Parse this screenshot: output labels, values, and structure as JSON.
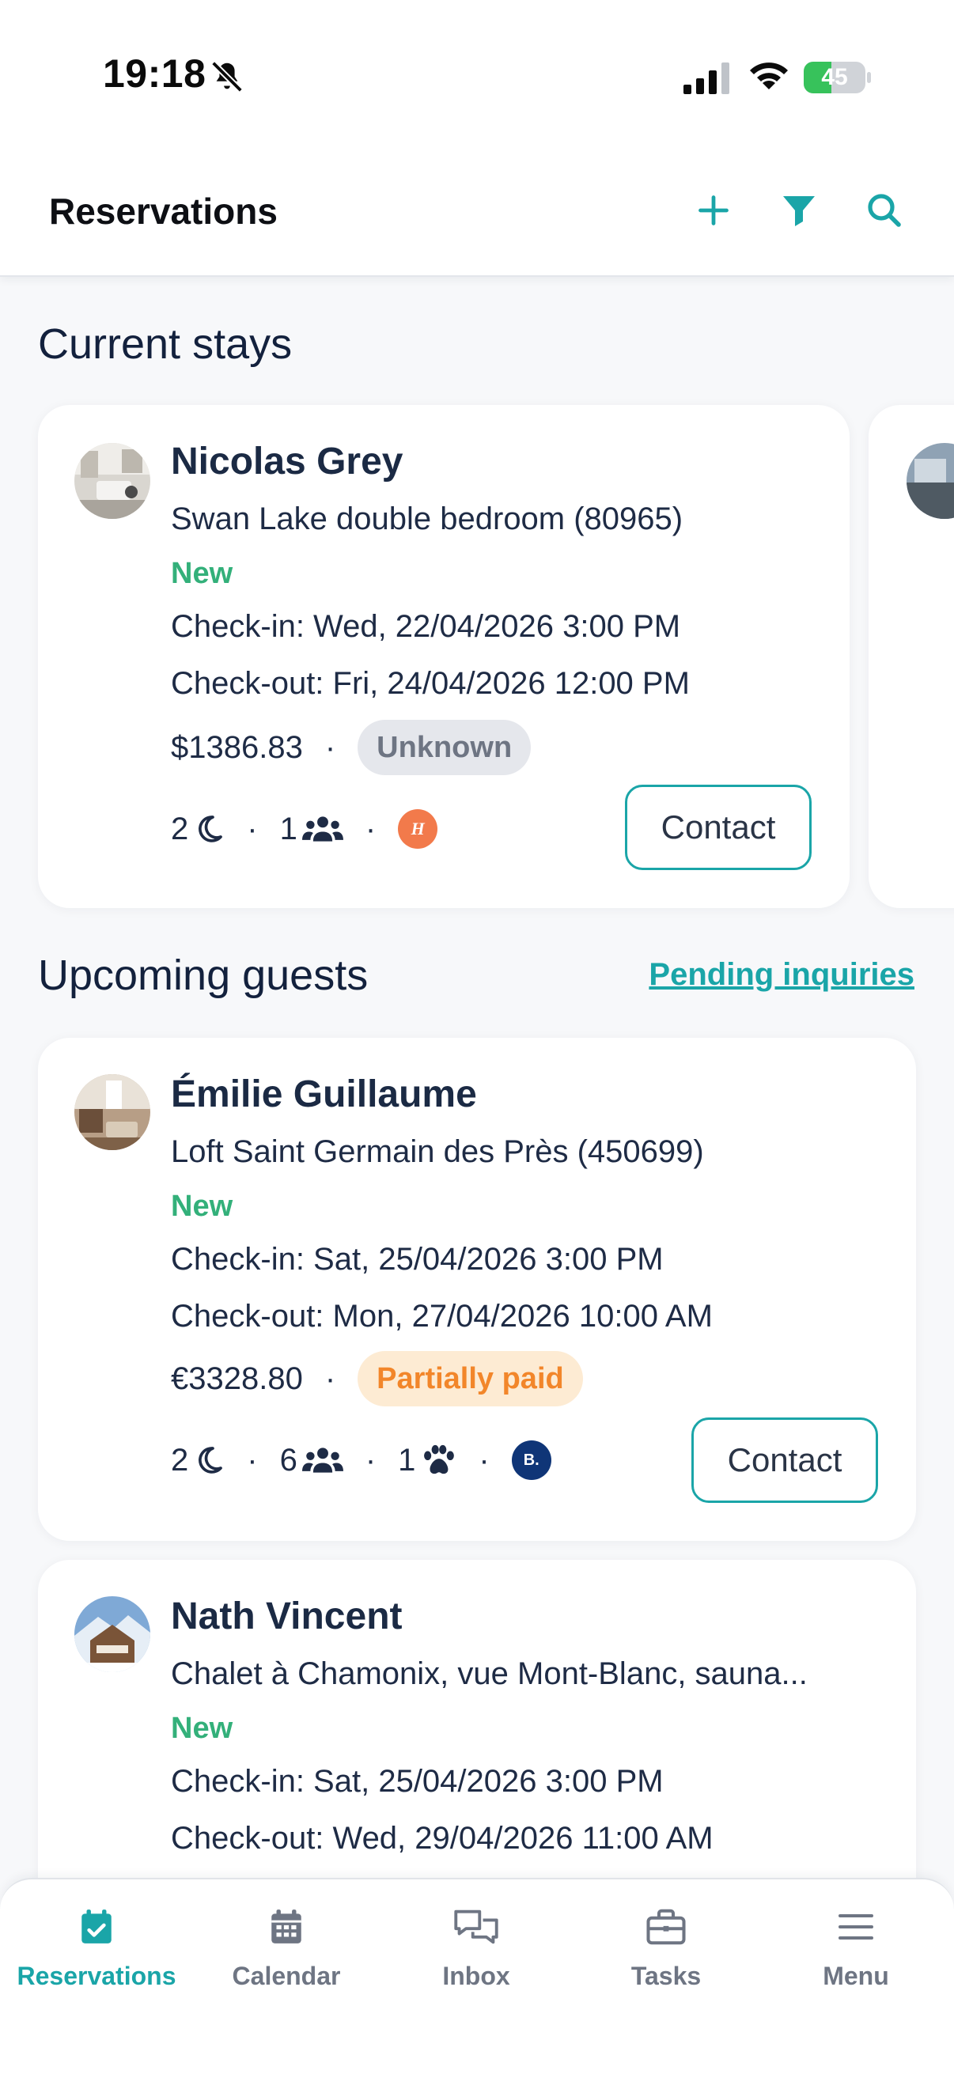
{
  "status_bar": {
    "time": "19:18",
    "battery": "45",
    "battery_level": 0.45
  },
  "header": {
    "title": "Reservations",
    "icons": [
      "plus-icon",
      "filter-icon",
      "search-icon"
    ]
  },
  "current": {
    "title": "Current stays",
    "cards": [
      {
        "name": "Nicolas Grey",
        "property": "Swan Lake double bedroom (80965)",
        "status": "New",
        "checkin": "Check-in: Wed, 22/04/2026 3:00 PM",
        "checkout": "Check-out: Fri, 24/04/2026 12:00 PM",
        "price": "$1386.83",
        "payment": "Unknown",
        "nights": "2",
        "guests": "1",
        "source": "H",
        "contact": "Contact"
      }
    ]
  },
  "upcoming": {
    "title": "Upcoming guests",
    "link": "Pending inquiries",
    "cards": [
      {
        "name": "Émilie Guillaume",
        "property": "Loft Saint Germain des Près (450699)",
        "status": "New",
        "checkin": "Check-in: Sat, 25/04/2026 3:00 PM",
        "checkout": "Check-out: Mon, 27/04/2026 10:00 AM",
        "price": "€3328.80",
        "payment": "Partially paid",
        "nights": "2",
        "guests": "6",
        "pets": "1",
        "source": "B.",
        "contact": "Contact"
      },
      {
        "name": "Nath Vincent",
        "property": "Chalet à Chamonix, vue Mont-Blanc, sauna...",
        "status": "New",
        "checkin": "Check-in: Sat, 25/04/2026 3:00 PM",
        "checkout": "Check-out: Wed, 29/04/2026 11:00 AM"
      }
    ]
  },
  "nav": [
    {
      "label": "Reservations",
      "icon": "calendar-check-icon",
      "active": true
    },
    {
      "label": "Calendar",
      "icon": "calendar-icon",
      "active": false
    },
    {
      "label": "Inbox",
      "icon": "chat-icon",
      "active": false
    },
    {
      "label": "Tasks",
      "icon": "briefcase-icon",
      "active": false
    },
    {
      "label": "Menu",
      "icon": "menu-icon",
      "active": false
    }
  ],
  "colors": {
    "accent": "#1AA5A8",
    "new": "#33B07A",
    "partial": "#F2862A",
    "navy": "#13213D"
  }
}
